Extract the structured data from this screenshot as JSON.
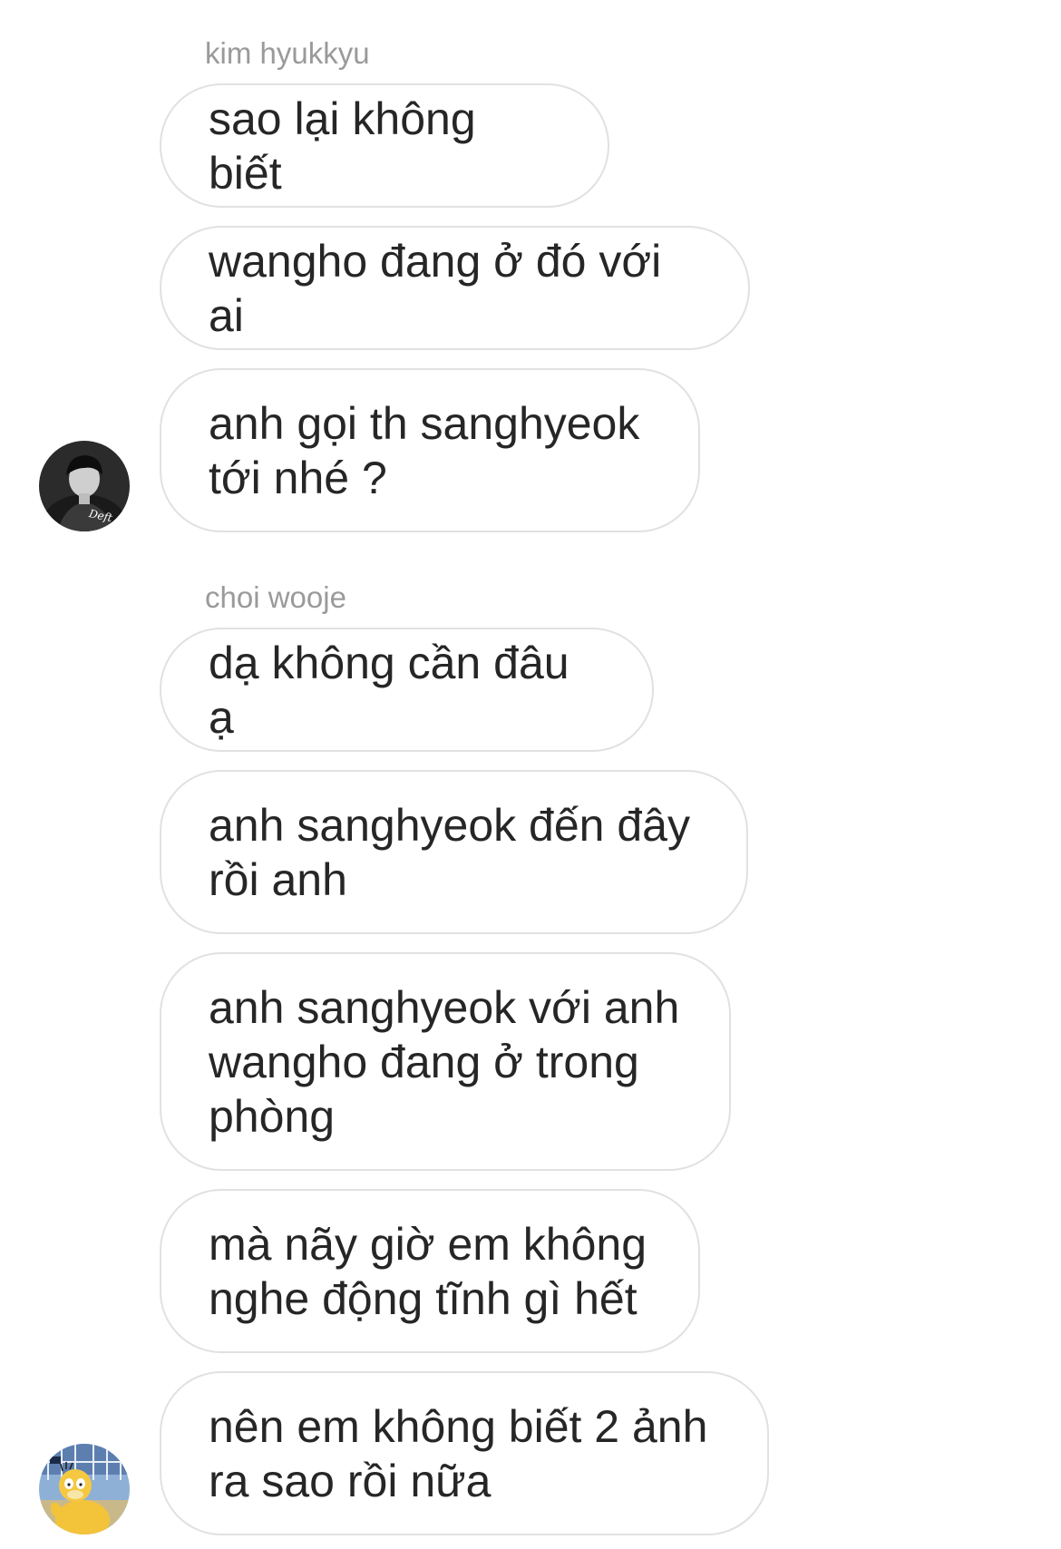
{
  "conversation": {
    "groups": [
      {
        "sender": "kim hyukkyu",
        "avatar_icon": "profile-photo-deft",
        "messages": [
          "sao lại không biết",
          "wangho đang ở đó với ai",
          "anh gọi th sanghyeok\ntới nhé ?"
        ]
      },
      {
        "sender": "choi wooje",
        "avatar_icon": "profile-photo-psyduck",
        "messages": [
          "dạ không cần đâu ạ",
          "anh sanghyeok đến đây\nrồi anh",
          "anh sanghyeok với anh\nwangho đang ở trong\nphòng",
          "mà nãy giờ em không\nnghe động tĩnh gì hết",
          "nên em không biết 2 ảnh\nra sao rồi nữa"
        ]
      }
    ]
  },
  "avatar_text": "Deft"
}
